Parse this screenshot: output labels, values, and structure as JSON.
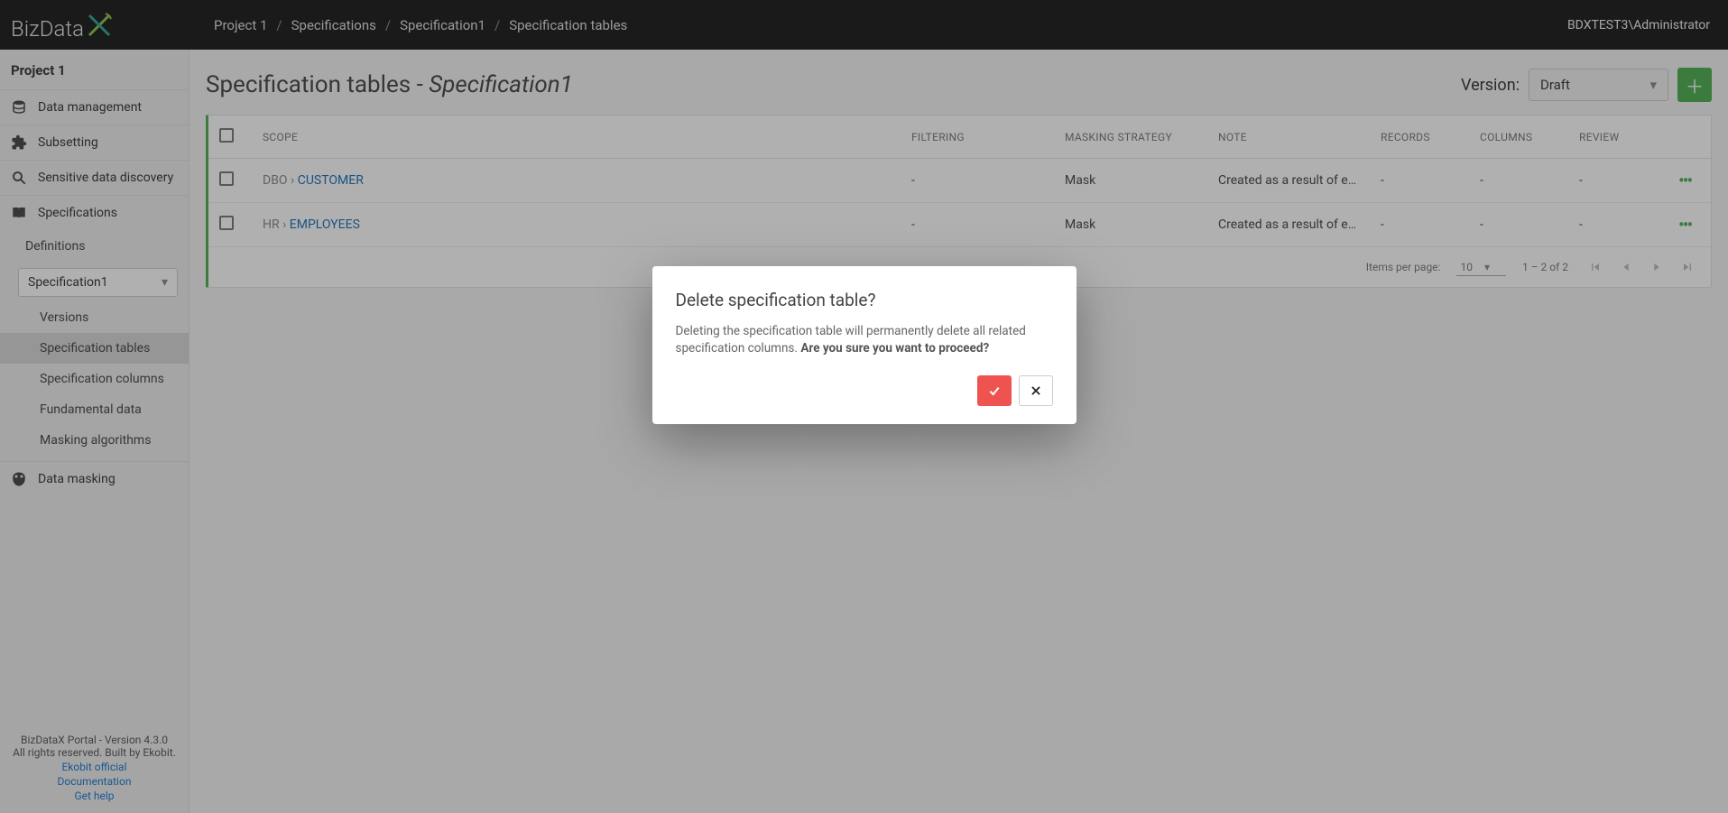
{
  "brand": {
    "name": "BizData"
  },
  "breadcrumbs": [
    "Project 1",
    "Specifications",
    "Specification1",
    "Specification tables"
  ],
  "user": "BDXTEST3\\Administrator",
  "sidebar": {
    "title": "Project 1",
    "items": [
      {
        "label": "Data management"
      },
      {
        "label": "Subsetting"
      },
      {
        "label": "Sensitive data discovery"
      },
      {
        "label": "Specifications"
      },
      {
        "label": "Data masking"
      }
    ],
    "definitions_label": "Definitions",
    "spec_select": "Specification1",
    "subnav": [
      "Versions",
      "Specification tables",
      "Specification columns",
      "Fundamental data",
      "Masking algorithms"
    ]
  },
  "footer": {
    "line1": "BizDataX Portal - Version 4.3.0",
    "line2": "All rights reserved. Built by Ekobit.",
    "links": [
      "Ekobit official",
      "Documentation",
      "Get help"
    ]
  },
  "page": {
    "title_prefix": "Specification tables - ",
    "title_spec": "Specification1",
    "version_label": "Version:",
    "version_value": "Draft"
  },
  "table": {
    "headers": [
      "SCOPE",
      "FILTERING",
      "MASKING STRATEGY",
      "NOTE",
      "RECORDS",
      "COLUMNS",
      "REVIEW"
    ],
    "rows": [
      {
        "scope_prefix": "DBO",
        "scope_name": "CUSTOMER",
        "filtering": "-",
        "masking": "Mask",
        "note": "Created as a result of exporti...",
        "records": "-",
        "columns": "-",
        "review": "-"
      },
      {
        "scope_prefix": "HR",
        "scope_name": "EMPLOYEES",
        "filtering": "-",
        "masking": "Mask",
        "note": "Created as a result of exporti...",
        "records": "-",
        "columns": "-",
        "review": "-"
      }
    ]
  },
  "paginator": {
    "items_label": "Items per page:",
    "page_size": "10",
    "range": "1 – 2 of 2"
  },
  "dialog": {
    "title": "Delete specification table?",
    "body_plain": "Deleting the specification table will permanently delete all related specification columns. ",
    "body_strong": "Are you sure you want to proceed?"
  }
}
